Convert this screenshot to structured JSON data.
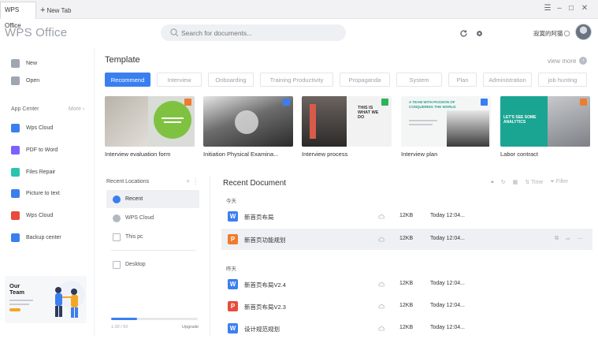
{
  "tabs": {
    "active": "WPS Office",
    "new_tab": "New Tab"
  },
  "header": {
    "logo": "WPS Office",
    "search_placeholder": "Search for documents...",
    "user_name": "寂寞的阿猫"
  },
  "sidebar": {
    "new_label": "New",
    "open_label": "Open",
    "section": "App Center",
    "more": "More",
    "apps": [
      {
        "label": "Wps Cloud",
        "color": "#3a7ff0"
      },
      {
        "label": "PDF to Word",
        "color": "#7b61ff"
      },
      {
        "label": "Files Repair",
        "color": "#2bc4b0"
      },
      {
        "label": "Picture to text",
        "color": "#3a7ff0"
      },
      {
        "label": "Wps Cloud",
        "color": "#e94b3c"
      },
      {
        "label": "Backup center",
        "color": "#3a7ff0"
      }
    ],
    "promo_title": "Our Team"
  },
  "templates": {
    "title": "Template",
    "view_more": "view more",
    "categories": [
      "Recommend",
      "Interview",
      "Onboarding",
      "Training Productivity",
      "Propaganda",
      "System",
      "Plan",
      "Administration",
      "job hunting"
    ],
    "cards": [
      {
        "label": "Interview evaluation form",
        "badge_color": "#f07b2e"
      },
      {
        "label": "Initiation Physical Examina...",
        "badge_color": "#3a7ff0"
      },
      {
        "label": "Interview process",
        "badge_color": "#2bb45b"
      },
      {
        "label": "Interview plan",
        "badge_color": "#3a7ff0",
        "thumb_title": "A TEAM WITH PASSION OF CONQUERING THE WORLD"
      },
      {
        "label": "Labor contract",
        "badge_color": "#f07b2e",
        "thumb_title": "LET'S SEE SOME ANALYTICS"
      }
    ],
    "card3_thumb": "THIS IS WHAT WE DO"
  },
  "locations": {
    "title": "Recent Locations",
    "items": [
      "Recent",
      "WPS Cloud",
      "This pc",
      "Desktop"
    ],
    "storage_text": "1.00 / 50",
    "upgrade": "Upgrade",
    "storage_used_fraction": 0.3
  },
  "recent_documents": {
    "title": "Recent Document",
    "tools": {
      "time": "Time",
      "filter": "Filter"
    },
    "groups": [
      {
        "label": "今天",
        "rows": [
          {
            "name": "新首页布局",
            "type": "W",
            "color": "#3a7ff0",
            "size": "12KB",
            "time": "Today 12:04..."
          },
          {
            "name": "新首页功能规划",
            "type": "P",
            "color": "#f07b2e",
            "size": "12KB",
            "time": "Today 12:04..."
          }
        ]
      },
      {
        "label": "昨天",
        "rows": [
          {
            "name": "新首页布局V2.4",
            "type": "W",
            "color": "#3a7ff0",
            "size": "12KB",
            "time": "Today 12:04..."
          },
          {
            "name": "新首页布局V2.3",
            "type": "P",
            "color": "#e94b3c",
            "size": "12KB",
            "time": "Today 12:04..."
          },
          {
            "name": "设计规范规划",
            "type": "W",
            "color": "#3a7ff0",
            "size": "12KB",
            "time": "Today 12:04..."
          }
        ]
      }
    ]
  }
}
